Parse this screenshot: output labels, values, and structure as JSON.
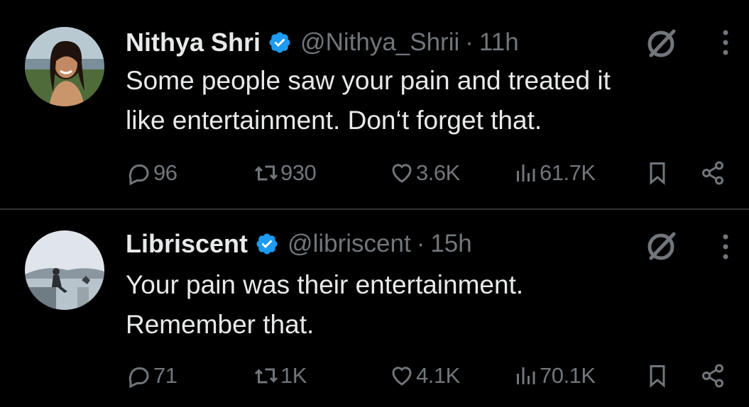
{
  "tweets": [
    {
      "author_name": "Nithya Shri",
      "handle": "@Nithya_Shrii",
      "separator": "·",
      "time": "11h",
      "text_line1": "Some people saw your pain and treated it",
      "text_line2": "like entertainment. Don‘t forget that.",
      "replies": "96",
      "reposts": "930",
      "likes": "3.6K",
      "views": "61.7K",
      "avatar_icon": "avatar-photo-woman-smiling",
      "verified": true
    },
    {
      "author_name": "Libriscent",
      "handle": "@libriscent",
      "separator": "·",
      "time": "15h",
      "text_line1": "Your pain was their entertainment.",
      "text_line2": "Remember that.",
      "replies": "71",
      "reposts": "1K",
      "likes": "4.1K",
      "views": "70.1K",
      "avatar_icon": "avatar-photo-person-on-wall-lake",
      "verified": true
    }
  ],
  "colors": {
    "background": "#000000",
    "primary_text": "#e7e9ea",
    "secondary_text": "#71767b",
    "verified_badge": "#1d9bf0",
    "divider": "#2f3336"
  },
  "icons": [
    "verified-badge-icon",
    "grok-icon",
    "more-icon",
    "reply-icon",
    "repost-icon",
    "like-icon",
    "views-icon",
    "bookmark-icon",
    "share-icon"
  ]
}
